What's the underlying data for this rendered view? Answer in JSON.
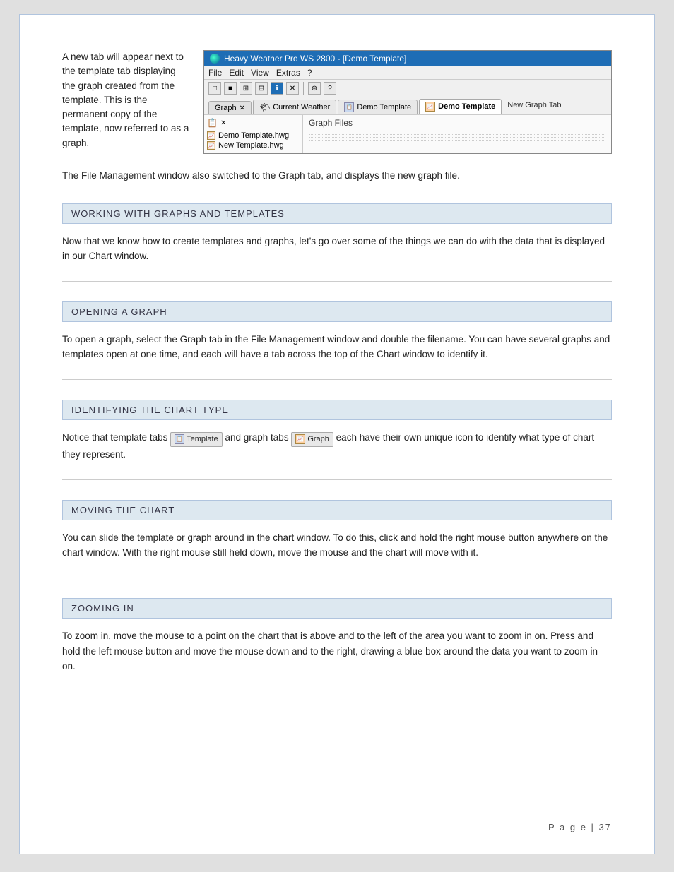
{
  "page": {
    "number": "P a g e  |  37"
  },
  "intro": {
    "left_text": "A new tab will appear next to the template tab displaying the graph created from the template. This is the permanent copy of the template, now referred to as a graph.",
    "paragraph2": "The File Management window also switched to the Graph tab, and displays the new graph file."
  },
  "app_window": {
    "title": "Heavy Weather Pro WS 2800 - [Demo Template]",
    "menu_items": [
      "File",
      "Edit",
      "View",
      "Extras",
      "?"
    ],
    "toolbar_buttons": [
      "□",
      "■",
      "⊞",
      "⊟",
      "ℹ",
      "✕",
      "⊛",
      "?"
    ],
    "panel_tab": "Graph",
    "panel_close": "✕",
    "tabs": [
      {
        "label": "Current Weather",
        "type": "weather",
        "active": false
      },
      {
        "label": "Demo Template",
        "type": "template",
        "active": false
      },
      {
        "label": "Demo Template",
        "type": "graph",
        "active": true
      }
    ],
    "new_graph_tab_label": "New Graph Tab",
    "files": [
      {
        "name": "Demo Template.hwg",
        "type": "graph"
      },
      {
        "name": "New Template.hwg",
        "type": "graph"
      }
    ],
    "right_panel_header": "Graph Files"
  },
  "sections": [
    {
      "id": "working-with-graphs",
      "heading": "WORKING WITH GRAPHS AND TEMPLATES",
      "body": "Now that we know how to create templates and graphs, let's go over some of the things we can do with the data that is displayed in our Chart window."
    },
    {
      "id": "opening-a-graph",
      "heading": "OPENING A GRAPH",
      "body": "To open a graph, select the Graph tab in the File Management window and double the filename. You can have several graphs and templates open at one time, and each will have a tab across the top of the Chart window to identify it."
    },
    {
      "id": "identifying-chart-type",
      "heading": "IDENTIFYING THE CHART TYPE",
      "body_prefix": "Notice that template tabs ",
      "template_label": "Template",
      "body_middle": " and graph tabs ",
      "graph_label": "Graph",
      "body_suffix": " each have their own unique icon to identify what type of chart they represent."
    },
    {
      "id": "moving-the-chart",
      "heading": "MOVING THE CHART",
      "body": "You can slide the template or graph around in the chart window. To do this, click and hold the right mouse button anywhere on the chart window. With the right mouse still held down, move the mouse and the chart will move with it."
    },
    {
      "id": "zooming-in",
      "heading": "ZOOMING IN",
      "body": "To zoom in, move the mouse to a point on the chart that is above and to the left of the area you want to zoom in on. Press and hold the left mouse button and move the mouse down and to the right, drawing a blue box around the data you want to zoom in on."
    }
  ]
}
